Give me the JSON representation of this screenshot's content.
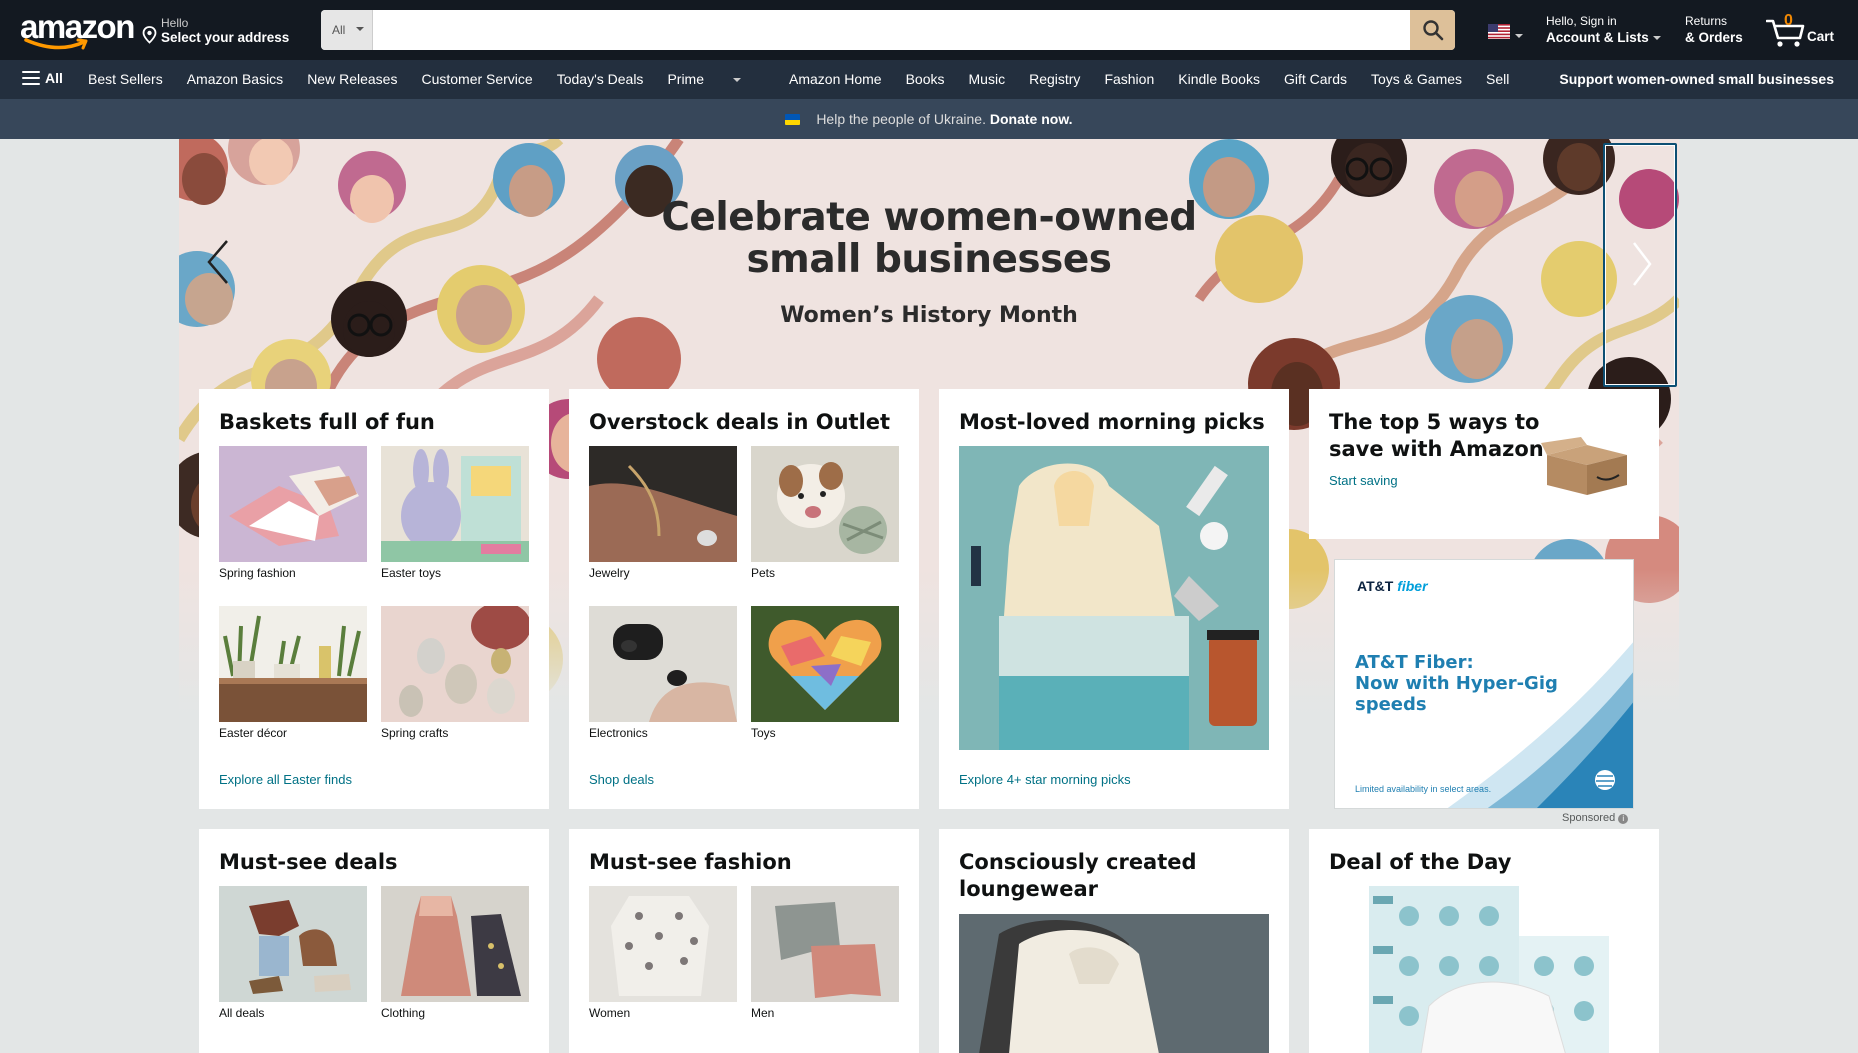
{
  "header": {
    "logo_text": "amazon",
    "deliver_line1": "Hello",
    "deliver_line2": "Select your address",
    "search_category": "All",
    "search_placeholder": "",
    "account_line1": "Hello, Sign in",
    "account_line2": "Account & Lists",
    "returns_line1": "Returns",
    "returns_line2": "& Orders",
    "cart_count": "0",
    "cart_label": "Cart"
  },
  "nav": {
    "all_label": "All",
    "links": [
      "Best Sellers",
      "Amazon Basics",
      "New Releases",
      "Customer Service",
      "Today's Deals",
      "Prime",
      "Amazon Home",
      "Books",
      "Music",
      "Registry",
      "Fashion",
      "Kindle Books",
      "Gift Cards",
      "Toys & Games",
      "Sell"
    ],
    "right_link": "Support women-owned small businesses"
  },
  "banner": {
    "text": "Help the people of Ukraine.",
    "link": "Donate now."
  },
  "hero": {
    "title_line1": "Celebrate women-owned",
    "title_line2": "small businesses",
    "subtitle": "Women’s History Month"
  },
  "cards": {
    "easter": {
      "title": "Baskets full of fun",
      "items": [
        "Spring fashion",
        "Easter toys",
        "Easter décor",
        "Spring crafts"
      ],
      "link": "Explore all Easter finds"
    },
    "outlet": {
      "title": "Overstock deals in Outlet",
      "items": [
        "Jewelry",
        "Pets",
        "Electronics",
        "Toys"
      ],
      "link": "Shop deals"
    },
    "morning": {
      "title": "Most-loved morning picks",
      "link": "Explore 4+ star morning picks"
    },
    "save": {
      "title_line1": "The top 5 ways to",
      "title_line2": "save with Amazon",
      "link": "Start saving"
    },
    "deals": {
      "title": "Must-see deals",
      "items": [
        "All deals",
        "Clothing"
      ]
    },
    "fashion": {
      "title": "Must-see fashion",
      "items": [
        "Women",
        "Men"
      ]
    },
    "lounge": {
      "title_line1": "Consciously created",
      "title_line2": "loungewear"
    },
    "dotd": {
      "title": "Deal of the Day"
    }
  },
  "ad": {
    "brand_att": "AT&T",
    "brand_fiber": "fiber",
    "headline_line1": "AT&T Fiber:",
    "headline_line2": "Now with Hyper-Gig speeds",
    "fine_print": "Limited availability in select areas.",
    "sponsored": "Sponsored"
  },
  "colors": {
    "header_bg": "#131921",
    "nav_bg": "#232f3e",
    "banner_bg": "#37475a",
    "link": "#007185",
    "search_button": "#ddc099",
    "page_bg": "#e3e6e6"
  }
}
